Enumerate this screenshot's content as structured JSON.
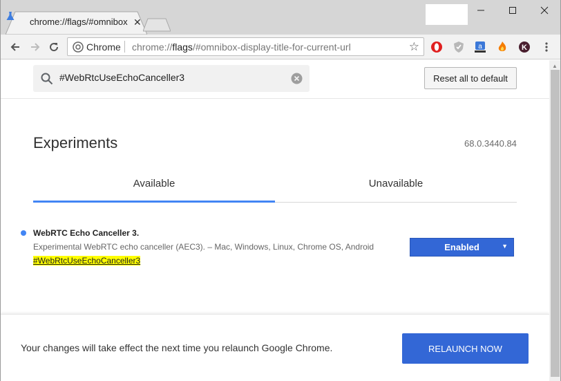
{
  "tab": {
    "title": "chrome://flags/#omnibox-display-title-for-current-url",
    "icon": "flask-icon"
  },
  "toolbar": {
    "site_label": "Chrome",
    "url_prefix": "chrome://",
    "url_host": "flags",
    "url_rest": "/#omnibox-display-title-for-current-url"
  },
  "search": {
    "value": "#WebRtcUseEchoCanceller3"
  },
  "header": {
    "reset_label": "Reset all to default"
  },
  "page": {
    "title": "Experiments",
    "version": "68.0.3440.84",
    "tabs": [
      "Available",
      "Unavailable"
    ]
  },
  "experiment": {
    "title": "WebRTC Echo Canceller 3.",
    "description": "Experimental WebRTC echo canceller (AEC3). – Mac, Windows, Linux, Chrome OS, Android",
    "link": "#WebRtcUseEchoCanceller3",
    "selected_value": "Enabled",
    "arrow": "▼"
  },
  "footer": {
    "message": "Your changes will take effect the next time you relaunch Google Chrome.",
    "button_label": "RELAUNCH NOW"
  },
  "colors": {
    "accent": "#3367d6",
    "tab_underline": "#4285f4",
    "highlight": "#ffff00"
  }
}
